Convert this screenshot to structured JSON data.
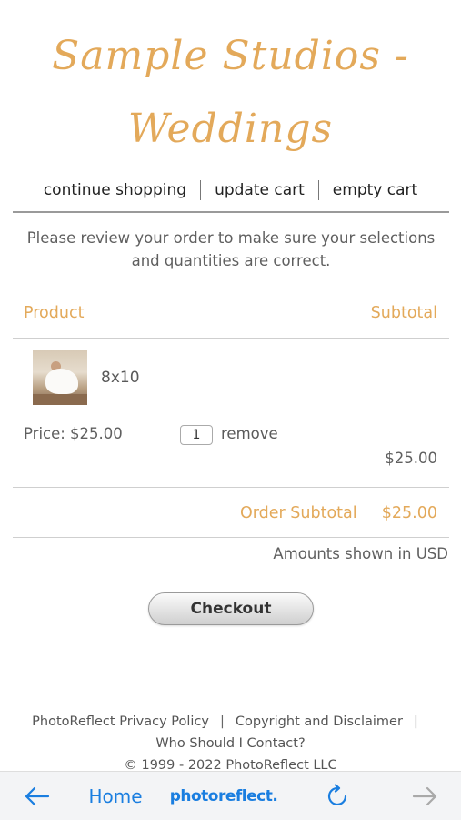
{
  "header": {
    "title_line1": "Sample Studios -",
    "title_line2": "Weddings"
  },
  "cart_nav": {
    "continue": "continue shopping",
    "update": "update cart",
    "empty": "empty cart"
  },
  "review_message": "Please review your order to make sure your selections and quantities are correct.",
  "table": {
    "product_header": "Product",
    "subtotal_header": "Subtotal"
  },
  "item": {
    "thumbnail_icon": "wedding-photo-thumbnail",
    "size": "8x10",
    "price": "Price: $25.00",
    "quantity": "1",
    "remove": "remove",
    "line_total": "$25.00"
  },
  "order_subtotal": {
    "label": "Order Subtotal",
    "value": "$25.00"
  },
  "currency_note": "Amounts shown in USD",
  "checkout_label": "Checkout",
  "footer": {
    "privacy": "PhotoReflect Privacy Policy",
    "sep": "|",
    "copyright": "Copyright and Disclaimer",
    "contact": "Who Should I Contact?",
    "copyright_line": "© 1999 - 2022 PhotoReflect LLC"
  },
  "toolbar": {
    "back_icon": "arrow-left-icon",
    "home_label": "Home",
    "brand": "photoreflect.",
    "reload_icon": "reload-icon",
    "forward_icon": "arrow-right-icon"
  },
  "colors": {
    "accent": "#e3a95a",
    "link_blue": "#1a7ee0"
  }
}
